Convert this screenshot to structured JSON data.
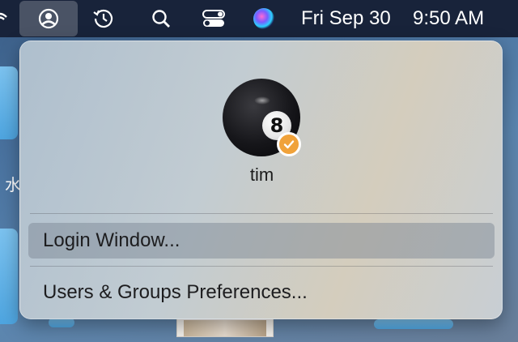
{
  "menubar": {
    "date": "Fri Sep 30",
    "time": "9:50 AM",
    "icons": [
      "user-account-icon",
      "time-machine-icon",
      "spotlight-search-icon",
      "control-center-icon",
      "siri-icon"
    ]
  },
  "user_menu": {
    "username": "tim",
    "avatar_ball_number": "8",
    "items": [
      {
        "label": "Login Window..."
      },
      {
        "label": "Users & Groups Preferences..."
      }
    ]
  },
  "desktop": {
    "left_char": "水"
  },
  "colors": {
    "menubar": "#18233a",
    "badge": "#f0a23a"
  }
}
